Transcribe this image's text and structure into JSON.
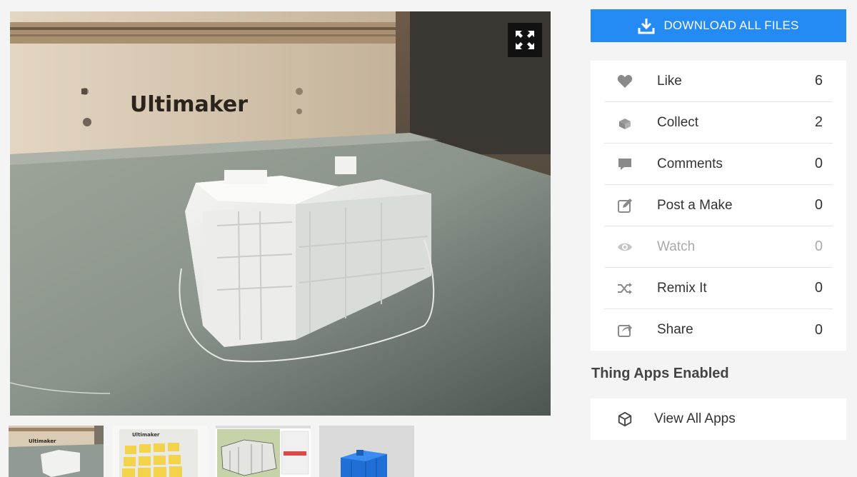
{
  "viewer": {
    "photo_alt": "White 3D printed building model on Ultimaker print bed",
    "brand_text": "Ultimaker",
    "expand_icon": "expand-arrows-icon"
  },
  "thumbnails": [
    {
      "name": "thumb-print-photo",
      "brand_text": "Ultimaker"
    },
    {
      "name": "thumb-yellow-prints",
      "brand_text": "Ultimaker"
    },
    {
      "name": "thumb-sketchup-model",
      "brand_text": ""
    },
    {
      "name": "thumb-blue-render",
      "brand_text": ""
    }
  ],
  "download": {
    "label": "DOWNLOAD ALL FILES",
    "icon": "download-icon"
  },
  "stats": [
    {
      "label": "Like",
      "count": "6",
      "icon": "heart-icon",
      "muted": false
    },
    {
      "label": "Collect",
      "count": "2",
      "icon": "collect-icon",
      "muted": false
    },
    {
      "label": "Comments",
      "count": "0",
      "icon": "comment-icon",
      "muted": false
    },
    {
      "label": "Post a Make",
      "count": "0",
      "icon": "edit-icon",
      "muted": false
    },
    {
      "label": "Watch",
      "count": "0",
      "icon": "eye-icon",
      "muted": true
    },
    {
      "label": "Remix It",
      "count": "0",
      "icon": "shuffle-icon",
      "muted": false
    },
    {
      "label": "Share",
      "count": "0",
      "icon": "share-icon",
      "muted": false
    }
  ],
  "apps": {
    "heading": "Thing Apps Enabled",
    "view_all_label": "View All Apps",
    "icon": "cube-icon"
  },
  "colors": {
    "accent": "#248bf5",
    "icon_gray": "#8a8a8a"
  }
}
